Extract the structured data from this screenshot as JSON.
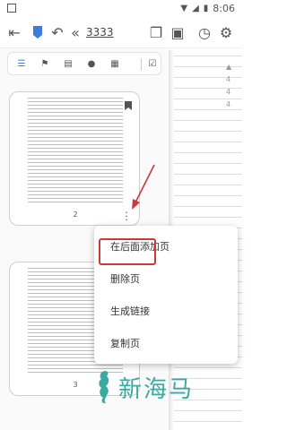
{
  "status": {
    "time": "8:06"
  },
  "toolbar": {
    "page_input": "3333"
  },
  "panel": {
    "tabs": [
      {
        "name": "list",
        "glyph": "☰"
      },
      {
        "name": "bookmark",
        "glyph": "⚑"
      },
      {
        "name": "outline",
        "glyph": "▤"
      },
      {
        "name": "search",
        "glyph": "●"
      },
      {
        "name": "notes",
        "glyph": "▦"
      },
      {
        "name": "select",
        "glyph": "☑"
      }
    ],
    "pages": [
      {
        "number": "2",
        "bookmarked": true
      },
      {
        "number": "3",
        "bookmarked": false
      }
    ]
  },
  "paper_indicator": [
    "4",
    "4",
    "4"
  ],
  "context_menu": {
    "items": [
      "在后面添加页",
      "删除页",
      "生成链接",
      "复制页"
    ],
    "highlighted": "删除页"
  },
  "watermark": {
    "text": "新海马"
  },
  "colors": {
    "accent": "#3b7ddd",
    "highlight": "#c93a3a",
    "watermark": "#3aa9a0"
  }
}
